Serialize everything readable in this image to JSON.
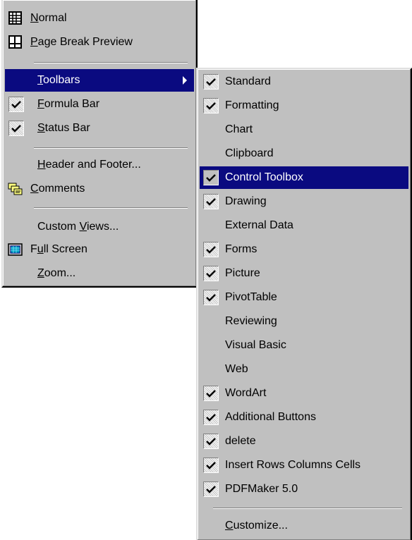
{
  "view_menu": {
    "items": [
      {
        "label": "Normal",
        "mnemonic": "N",
        "icon": "normal-view-icon"
      },
      {
        "label": "Page Break Preview",
        "mnemonic": "P",
        "icon": "page-break-preview-icon"
      },
      {
        "label": "Toolbars",
        "mnemonic": "T",
        "selected": true,
        "has_submenu": true
      },
      {
        "label": "Formula Bar",
        "mnemonic": "F",
        "checked": true
      },
      {
        "label": "Status Bar",
        "mnemonic": "S",
        "checked": true
      },
      {
        "label": "Header and Footer...",
        "mnemonic": "H"
      },
      {
        "label": "Comments",
        "mnemonic": "C",
        "icon": "comments-icon"
      },
      {
        "label": "Custom Views...",
        "mnemonic": "V"
      },
      {
        "label": "Full Screen",
        "mnemonic": "u",
        "icon": "full-screen-icon"
      },
      {
        "label": "Zoom...",
        "mnemonic": "Z"
      }
    ]
  },
  "toolbars_menu": {
    "items": [
      {
        "label": "Standard",
        "checked": true
      },
      {
        "label": "Formatting",
        "checked": true
      },
      {
        "label": "Chart",
        "checked": false
      },
      {
        "label": "Clipboard",
        "checked": false
      },
      {
        "label": "Control Toolbox",
        "checked": true,
        "selected": true
      },
      {
        "label": "Drawing",
        "checked": true
      },
      {
        "label": "External Data",
        "checked": false
      },
      {
        "label": "Forms",
        "checked": true
      },
      {
        "label": "Picture",
        "checked": true
      },
      {
        "label": "PivotTable",
        "checked": true
      },
      {
        "label": "Reviewing",
        "checked": false
      },
      {
        "label": "Visual Basic",
        "checked": false
      },
      {
        "label": "Web",
        "checked": false
      },
      {
        "label": "WordArt",
        "checked": true
      },
      {
        "label": "Additional Buttons",
        "checked": true
      },
      {
        "label": "delete",
        "checked": true
      },
      {
        "label": "Insert Rows Columns Cells",
        "checked": true
      },
      {
        "label": "PDFMaker 5.0",
        "checked": true
      },
      {
        "label": "Customize...",
        "mnemonic": "C"
      }
    ]
  },
  "colors": {
    "menu_bg": "#c0c0c0",
    "highlight": "#0a0a80",
    "highlight_text": "#ffffff"
  }
}
